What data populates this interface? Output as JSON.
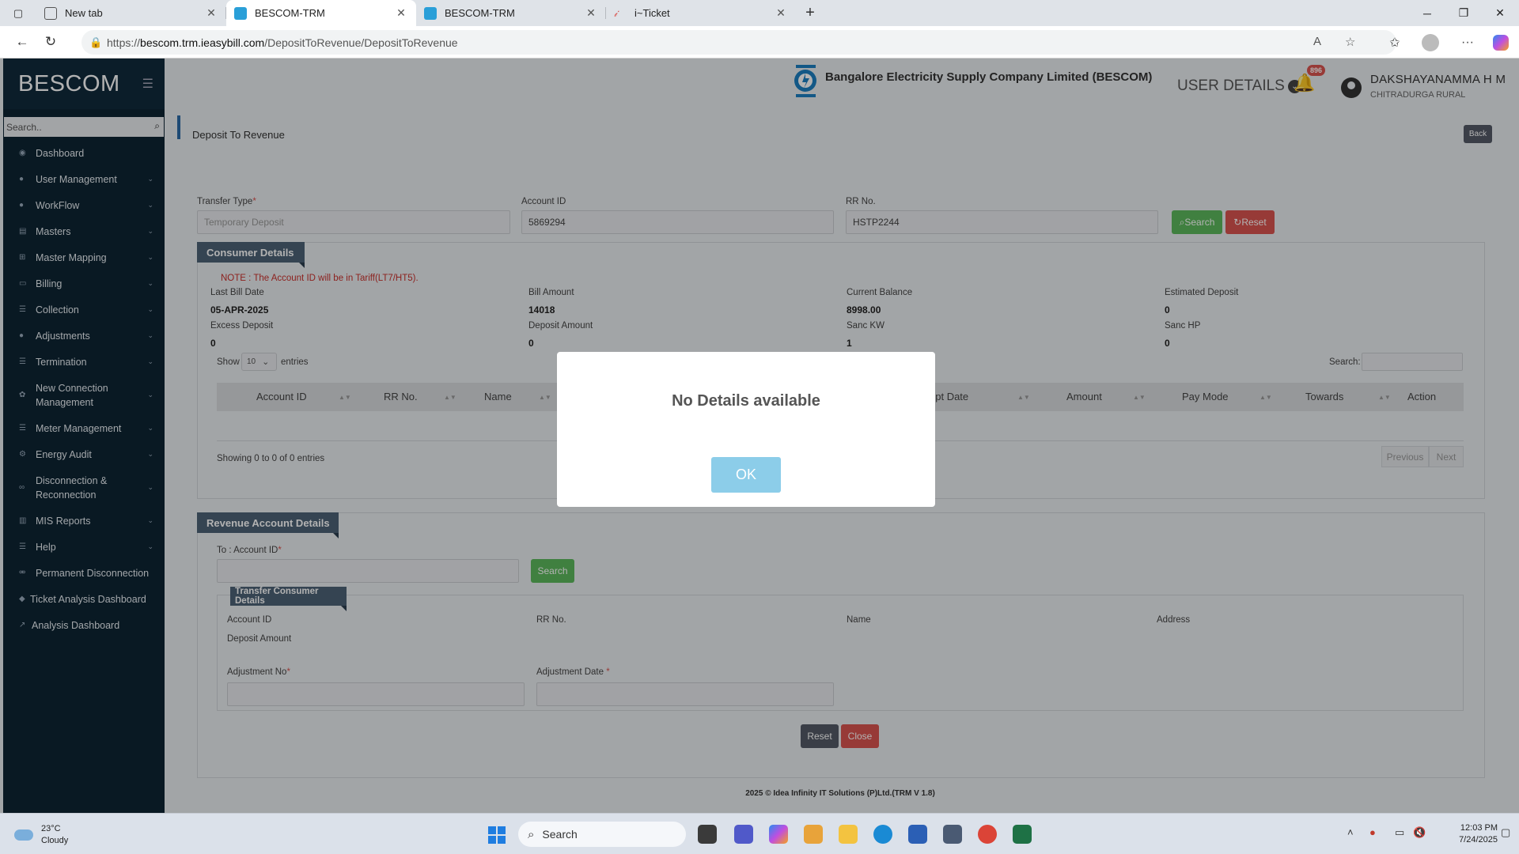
{
  "browser": {
    "tabs": [
      {
        "title": "New tab"
      },
      {
        "title": "BESCOM-TRM"
      },
      {
        "title": "BESCOM-TRM"
      },
      {
        "title": "i~Ticket"
      }
    ],
    "url_prefix": "https://",
    "url_domain": "bescom.trm.ieasybill.com",
    "url_path": "/DepositToRevenue/DepositToRevenue"
  },
  "sidebar": {
    "brand": "BESCOM",
    "search_placeholder": "Search..",
    "items": [
      {
        "label": "Dashboard"
      },
      {
        "label": "User Management"
      },
      {
        "label": "WorkFlow"
      },
      {
        "label": "Masters"
      },
      {
        "label": "Master Mapping"
      },
      {
        "label": "Billing"
      },
      {
        "label": "Collection"
      },
      {
        "label": "Adjustments"
      },
      {
        "label": "Termination"
      },
      {
        "label": "New Connection Management"
      },
      {
        "label": "Meter Management"
      },
      {
        "label": "Energy Audit"
      },
      {
        "label": "Disconnection & Reconnection"
      },
      {
        "label": "MIS Reports"
      },
      {
        "label": "Help"
      },
      {
        "label": "Permanent Disconnection"
      },
      {
        "label": "Ticket Analysis Dashboard"
      },
      {
        "label": "Analysis Dashboard"
      }
    ]
  },
  "header": {
    "company": "Bangalore Electricity Supply Company Limited (BESCOM)",
    "user_details": "USER DETAILS",
    "notifications": "896",
    "user_name": "DAKSHAYANAMMA H M",
    "user_location": "CHITRADURGA RURAL"
  },
  "page": {
    "title": "Deposit To Revenue",
    "back": "Back",
    "transfer_type_label": "Transfer Type",
    "transfer_type_value": "Temporary Deposit",
    "account_id_label": "Account ID",
    "account_id_value": "5869294",
    "rr_label": "RR No.",
    "rr_value": "HSTP2244",
    "search_btn": "Search",
    "reset_btn": "Reset"
  },
  "consumer": {
    "title": "Consumer Details",
    "note": "NOTE : The Account ID will be in Tariff(LT7/HT5).",
    "fields": [
      {
        "label": "Last Bill Date",
        "value": "05-APR-2025"
      },
      {
        "label": "Bill Amount",
        "value": "14018"
      },
      {
        "label": "Current Balance",
        "value": "8998.00"
      },
      {
        "label": "Estimated Deposit",
        "value": "0"
      },
      {
        "label": "Excess Deposit",
        "value": "0"
      },
      {
        "label": "Deposit Amount",
        "value": "0"
      },
      {
        "label": "Sanc KW",
        "value": "1"
      },
      {
        "label": "Sanc HP",
        "value": "0"
      }
    ],
    "show": "Show",
    "entries_count": "10",
    "entries": "entries",
    "search_label": "Search:",
    "columns": [
      "Account ID",
      "RR No.",
      "Name",
      "Receipt Date",
      "Amount",
      "Pay Mode",
      "Towards",
      "Action"
    ],
    "info": "Showing 0 to 0 of 0 entries",
    "prev": "Previous",
    "next": "Next"
  },
  "revenue": {
    "title": "Revenue Account Details",
    "to_account_label": "To : Account ID",
    "search_btn": "Search",
    "transfer_title": "Transfer Consumer Details",
    "account_id": "Account ID",
    "rr_no": "RR No.",
    "name": "Name",
    "address": "Address",
    "deposit_amount": "Deposit Amount",
    "adj_no": "Adjustment No",
    "adj_date": "Adjustment Date",
    "reset": "Reset",
    "close": "Close"
  },
  "footer": "2025 © Idea Infinity IT Solutions (P)Ltd.(TRM V 1.8)",
  "modal": {
    "message": "No Details available",
    "ok": "OK"
  },
  "taskbar": {
    "temp": "23°C",
    "weather": "Cloudy",
    "search": "Search",
    "time": "12:03 PM",
    "date": "7/24/2025"
  }
}
